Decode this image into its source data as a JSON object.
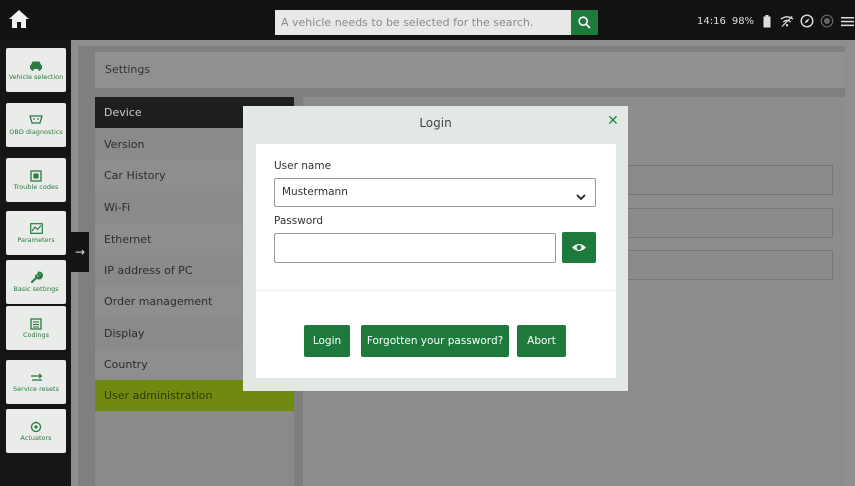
{
  "topbar": {
    "search_placeholder": "A vehicle needs to be selected for the search.",
    "time": "14:16",
    "battery": "98%"
  },
  "nav": {
    "items": [
      {
        "label": "Vehicle selection",
        "icon": "car-icon"
      },
      {
        "label": "OBD diagnostics",
        "icon": "obd-icon"
      },
      {
        "label": "Trouble codes",
        "icon": "trouble-codes-icon"
      },
      {
        "label": "Parameters",
        "icon": "parameters-icon"
      },
      {
        "label": "Basic settings",
        "icon": "wrench-icon"
      },
      {
        "label": "Codings",
        "icon": "codings-icon"
      },
      {
        "label": "Service resets",
        "icon": "service-reset-icon"
      },
      {
        "label": "Actuators",
        "icon": "actuators-icon"
      }
    ]
  },
  "settings": {
    "header": "Settings",
    "menu": [
      "Device",
      "Version",
      "Car History",
      "Wi-Fi",
      "Ethernet",
      "IP address of PC",
      "Order management",
      "Display",
      "Country",
      "User administration"
    ]
  },
  "login": {
    "title": "Login",
    "username_label": "User name",
    "username_value": "Mustermann",
    "password_label": "Password",
    "password_value": "",
    "login_button": "Login",
    "forgot_button": "Forgotten your password?",
    "abort_button": "Abort"
  },
  "colors": {
    "accent": "#1e7a3c",
    "highlight": "#6f8a0f"
  }
}
